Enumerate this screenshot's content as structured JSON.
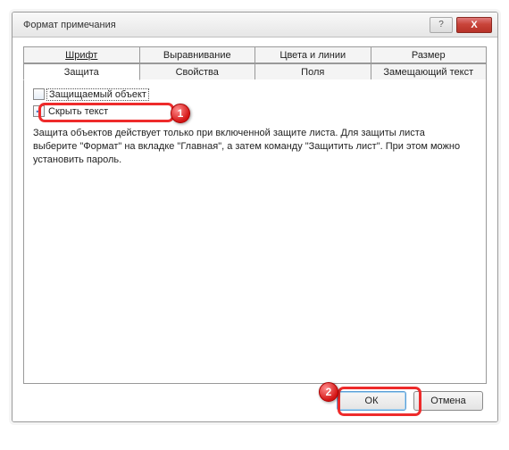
{
  "window": {
    "title": "Формат примечания",
    "help_label": "?",
    "close_label": "X"
  },
  "tabs": {
    "row1": [
      {
        "label": "Шрифт",
        "underline": true
      },
      {
        "label": "Выравнивание",
        "underline": false
      },
      {
        "label": "Цвета и линии",
        "underline": false
      },
      {
        "label": "Размер",
        "underline": false
      }
    ],
    "row2": [
      {
        "label": "Защита",
        "underline": false,
        "active": true
      },
      {
        "label": "Свойства",
        "underline": false
      },
      {
        "label": "Поля",
        "underline": false
      },
      {
        "label": "Замещающий текст",
        "underline": false
      }
    ]
  },
  "protection": {
    "lock_checkbox": {
      "label": "Защищаемый объект",
      "checked": false
    },
    "hide_checkbox": {
      "label": "Скрыть текст",
      "checked": true
    },
    "description": "Защита объектов действует только при включенной защите листа. Для защиты листа выберите \"Формат\" на вкладке \"Главная\", а затем команду \"Защитить лист\". При этом можно установить пароль."
  },
  "buttons": {
    "ok": "ОК",
    "cancel": "Отмена"
  },
  "annotations": {
    "badge1": "1",
    "badge2": "2"
  }
}
